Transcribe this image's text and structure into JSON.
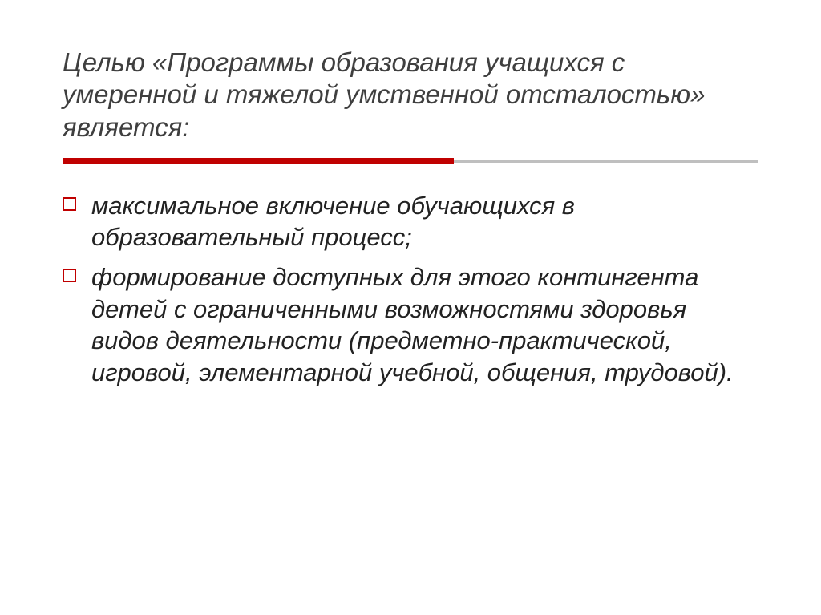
{
  "title": "Целью «Программы образования учащихся с умеренной и тяжелой умственной отсталостью» является:",
  "bullets": [
    "максимальное включение обучающихся в образовательный процесс;",
    "формирование доступных для этого контингента детей с ограниченными возможностями здоровья видов деятельности (предметно-практической, игровой, элементарной учебной, общения, трудовой)."
  ],
  "colors": {
    "accent": "#c00000",
    "title": "#3f3f3f",
    "rule_gray": "#bfbfbf"
  }
}
